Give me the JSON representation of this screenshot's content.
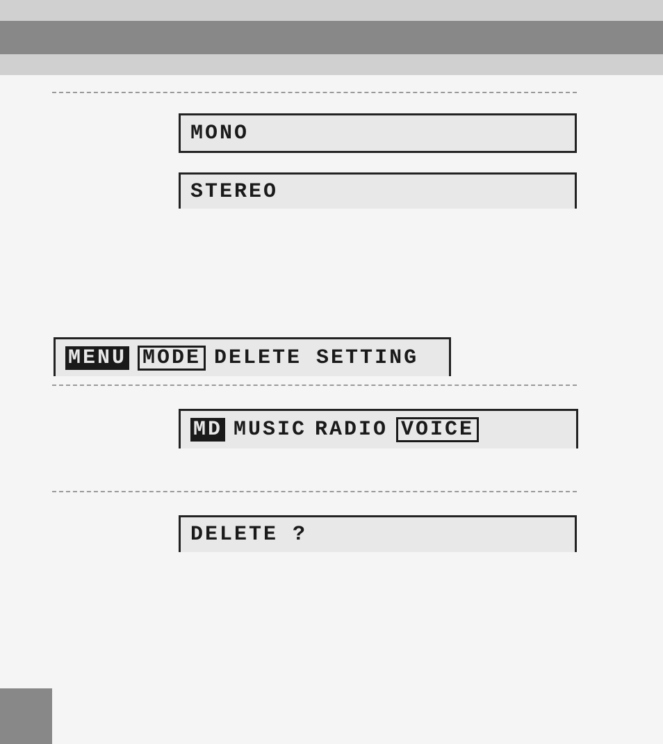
{
  "options": {
    "mono": "MONO",
    "stereo": "STEREO"
  },
  "deleteSetting": {
    "tag1": "MENU",
    "tag2": "MODE",
    "label": "DELETE SETTING"
  },
  "modeRow": {
    "tag": "MD",
    "option1": "MUSIC",
    "option2": "RADIO",
    "option3": "VOICE"
  },
  "confirm": {
    "label": "DELETE ?"
  }
}
